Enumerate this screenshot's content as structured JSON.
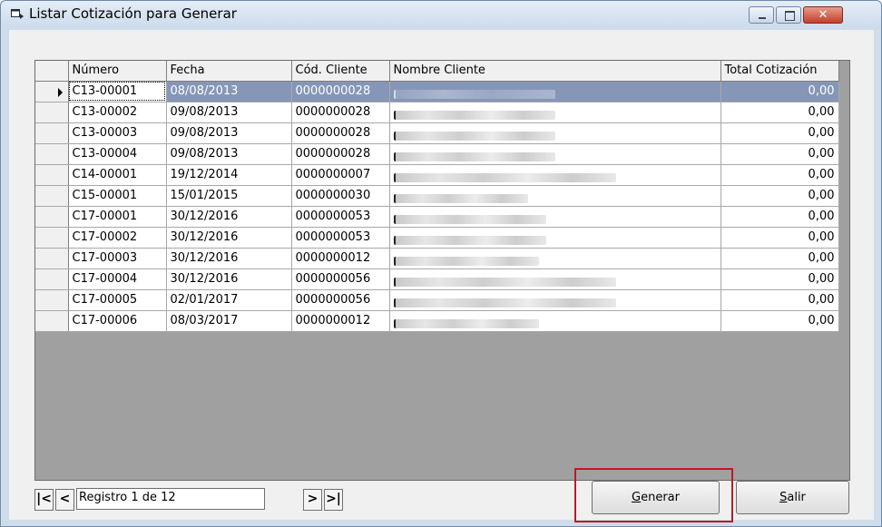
{
  "window": {
    "title": "Listar Cotización para Generar",
    "close_glyph": "✕"
  },
  "grid": {
    "columns": [
      "Número",
      "Fecha",
      "Cód. Cliente",
      "Nombre Cliente",
      "Total Cotización"
    ],
    "rows": [
      {
        "numero": "C13-00001",
        "fecha": "08/08/2013",
        "cod": "0000000028",
        "total": "0,00",
        "current": true
      },
      {
        "numero": "C13-00002",
        "fecha": "09/08/2013",
        "cod": "0000000028",
        "total": "0,00"
      },
      {
        "numero": "C13-00003",
        "fecha": "09/08/2013",
        "cod": "0000000028",
        "total": "0,00"
      },
      {
        "numero": "C13-00004",
        "fecha": "09/08/2013",
        "cod": "0000000028",
        "total": "0,00"
      },
      {
        "numero": "C14-00001",
        "fecha": "19/12/2014",
        "cod": "0000000007",
        "total": "0,00"
      },
      {
        "numero": "C15-00001",
        "fecha": "15/01/2015",
        "cod": "0000000030",
        "total": "0,00"
      },
      {
        "numero": "C17-00001",
        "fecha": "30/12/2016",
        "cod": "0000000053",
        "total": "0,00"
      },
      {
        "numero": "C17-00002",
        "fecha": "30/12/2016",
        "cod": "0000000053",
        "total": "0,00"
      },
      {
        "numero": "C17-00003",
        "fecha": "30/12/2016",
        "cod": "0000000012",
        "total": "0,00"
      },
      {
        "numero": "C17-00004",
        "fecha": "30/12/2016",
        "cod": "0000000056",
        "total": "0,00"
      },
      {
        "numero": "C17-00005",
        "fecha": "02/01/2017",
        "cod": "0000000056",
        "total": "0,00"
      },
      {
        "numero": "C17-00006",
        "fecha": "08/03/2017",
        "cod": "0000000012",
        "total": "0,00"
      }
    ]
  },
  "navigation": {
    "first": "|<",
    "prev": "<",
    "record": "Registro 1 de 12",
    "next": ">",
    "last": ">|"
  },
  "actions": {
    "generar_first": "G",
    "generar_rest": "enerar",
    "salir_first": "S",
    "salir_rest": "alir"
  },
  "colors": {
    "selection": "#8596b8",
    "highlight_border": "#b81c24"
  }
}
